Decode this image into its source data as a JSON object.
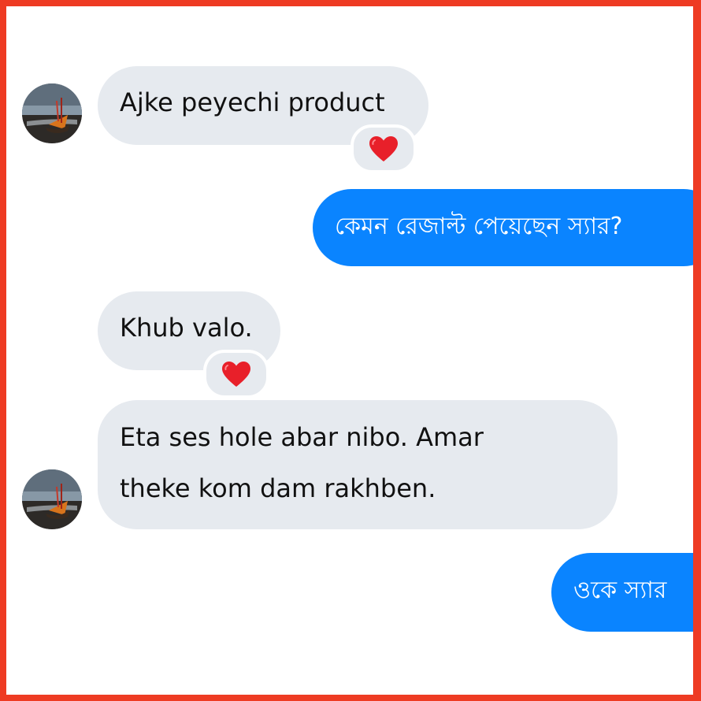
{
  "conversation": {
    "messages": [
      {
        "sender": "incoming",
        "text": "Ajke peyechi product",
        "reaction": "heart-icon"
      },
      {
        "sender": "outgoing",
        "text": "কেমন রেজাল্ট পেয়েছেন স্যার?"
      },
      {
        "sender": "incoming",
        "text": "Khub valo.",
        "reaction": "heart-icon"
      },
      {
        "sender": "incoming",
        "lines": [
          "Eta ses hole abar nibo.  Amar",
          "theke kom dam rakhben."
        ]
      },
      {
        "sender": "outgoing",
        "text": "ওকে স্যার"
      }
    ]
  },
  "colors": {
    "frame_border": "#ee3b23",
    "incoming_bubble": "#e6eaef",
    "outgoing_bubble": "#0a84ff",
    "reaction_heart": "#e8202a"
  }
}
